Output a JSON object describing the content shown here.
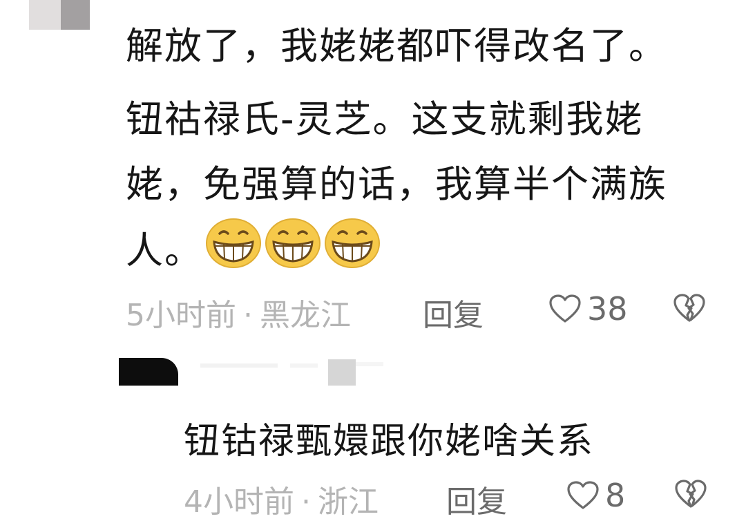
{
  "comments": [
    {
      "lines": [
        "解放了，我姥姥都吓得改名了。",
        "钮祜禄氏-灵芝。这支就剩我姥",
        "姥，免强算的话，我算半个满族",
        "人。"
      ],
      "emojis": [
        "grin-emoji",
        "grin-emoji",
        "grin-emoji"
      ],
      "time": "5小时前",
      "separator": "·",
      "location": "黑龙江",
      "reply_label": "回复",
      "likes": "38"
    },
    {
      "text": "钮钴禄甄嬛跟你姥啥关系",
      "time": "4小时前",
      "separator": "·",
      "location": "浙江",
      "reply_label": "回复",
      "likes": "8"
    }
  ],
  "colors": {
    "text": "#161616",
    "meta": "#b4b4b4",
    "action": "#6b6b6b",
    "emoji_face": "#f6c94a"
  }
}
